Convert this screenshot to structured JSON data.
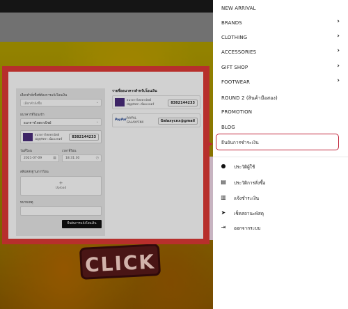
{
  "form": {
    "order_placeholder": "เลือกคำสั่งซื้อ",
    "order_label": "เลือกคำสั่งซื้อที่ต้องการแจ้งโอนเงิน",
    "bank_label": "ธนาคารที่โอนเข้า",
    "bank_selected": "ธนาคารไทยพาณิชย์",
    "bank_card_line1": "ธนาคารไทยพาณิชย์",
    "bank_card_line2": "ณัฐฐุพัชชา เนื่องเกษตร์",
    "bank_card_account": "8382144233",
    "date_label": "วันที่โอน",
    "date_value": "2021-07-09",
    "time_label": "เวลาที่โอน",
    "time_value": "18:31:30",
    "slip_label": "สลิปหลักฐานการโอน",
    "upload_icon": "+",
    "upload_label": "Upload",
    "note_label": "หมายเหตุ",
    "submit_label": "ยืนยันการแจ้งโอนเงิน"
  },
  "bank_list": {
    "title": "รายชื่อธนาคารสำหรับโอนเงิน",
    "items": [
      {
        "line1": "ธนาคารไทยพาณิชย์",
        "line2": "ณัฐฐุพัชชา เนื่องเกษตร์",
        "account": "8382144233",
        "logo": "scb-logo"
      },
      {
        "line1": "PAYPAL",
        "line2": "GALAXYCNX",
        "account": "Galaxycnx@gmail",
        "logo": "paypal-logo",
        "logo_text": "PayPal"
      }
    ]
  },
  "background": {
    "banner_text": "CLICK"
  },
  "menu": {
    "items": [
      {
        "label": "NEW ARRIVAL",
        "has_chevron": false
      },
      {
        "label": "BRANDS",
        "has_chevron": true
      },
      {
        "label": "CLOTHING",
        "has_chevron": true
      },
      {
        "label": "ACCESSORIES",
        "has_chevron": true
      },
      {
        "label": "GIFT SHOP",
        "has_chevron": true
      },
      {
        "label": "FOOTWEAR",
        "has_chevron": true
      },
      {
        "label": "ROUND 2 (สินค้ามือสอง)",
        "has_chevron": false
      },
      {
        "label": "PROMOTION",
        "has_chevron": false
      },
      {
        "label": "BLOG",
        "has_chevron": false
      },
      {
        "label": "ยืนยันการชำระเงิน",
        "has_chevron": false,
        "selected": true
      }
    ],
    "account_items": [
      {
        "label": "ประวัติผู้ใช้",
        "icon": "user-icon"
      },
      {
        "label": "ประวัติการสั่งซื้อ",
        "icon": "document-icon"
      },
      {
        "label": "แจ้งชำระเงิน",
        "icon": "money-icon"
      },
      {
        "label": "เช็คสถานะพัสดุ",
        "icon": "paper-plane-icon"
      },
      {
        "label": "ออกจากระบบ",
        "icon": "logout-icon"
      }
    ]
  },
  "colors": {
    "highlight": "#c0243a",
    "frame": "#e03a36",
    "bank_logo": "#4b2c7d"
  }
}
